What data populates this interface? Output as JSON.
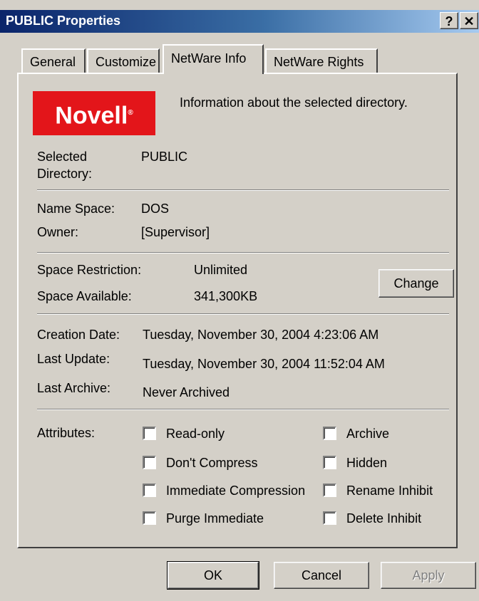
{
  "window": {
    "title": "PUBLIC Properties",
    "help_glyph": "?",
    "close_glyph": "✕"
  },
  "tabs": [
    {
      "label": "General",
      "active": false
    },
    {
      "label": "Customize",
      "active": false
    },
    {
      "label": "NetWare Info",
      "active": true
    },
    {
      "label": "NetWare Rights",
      "active": false
    }
  ],
  "logo": {
    "text": "Novell",
    "mark": "®"
  },
  "description": "Information about the selected directory.",
  "selected_directory": {
    "label_line1": "Selected",
    "label_line2": "Directory:",
    "value": "PUBLIC"
  },
  "name_space": {
    "label": "Name Space:",
    "value": "DOS"
  },
  "owner": {
    "label": "Owner:",
    "value": "[Supervisor]"
  },
  "space_restriction": {
    "label": "Space Restriction:",
    "value": "Unlimited"
  },
  "space_available": {
    "label": "Space Available:",
    "value": "341,300KB"
  },
  "change_button": "Change",
  "creation_date": {
    "label": "Creation Date:",
    "value": "Tuesday, November 30, 2004 4:23:06 AM"
  },
  "last_update": {
    "label": "Last Update:",
    "value": "Tuesday, November 30, 2004 11:52:04 AM"
  },
  "last_archive": {
    "label": "Last Archive:",
    "value": "Never Archived"
  },
  "attributes": {
    "label": "Attributes:",
    "left": [
      {
        "label": "Read-only",
        "checked": false
      },
      {
        "label": "Don't Compress",
        "checked": false
      },
      {
        "label": "Immediate Compression",
        "checked": false
      },
      {
        "label": "Purge Immediate",
        "checked": false
      }
    ],
    "right": [
      {
        "label": "Archive",
        "checked": false
      },
      {
        "label": "Hidden",
        "checked": false
      },
      {
        "label": "Rename Inhibit",
        "checked": false
      },
      {
        "label": "Delete Inhibit",
        "checked": false
      }
    ]
  },
  "footer": {
    "ok": "OK",
    "cancel": "Cancel",
    "apply": "Apply"
  }
}
